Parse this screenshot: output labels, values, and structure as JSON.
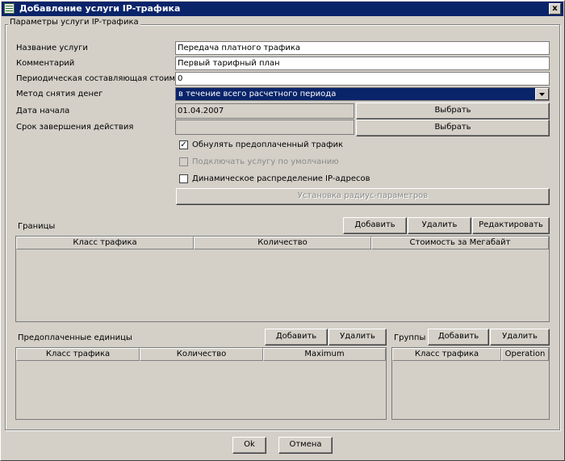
{
  "window": {
    "title": "Добавление услуги IP-трафика",
    "close": "x"
  },
  "group": {
    "legend": "Параметры услуги IP-трафика"
  },
  "form": {
    "service_name_label": "Название услуги",
    "service_name_value": "Передача платного трафика",
    "comment_label": "Комментарий",
    "comment_value": "Первый тарифный план",
    "periodic_label": "Периодическая составляющая стоимости",
    "periodic_value": "0",
    "method_label": "Метод снятия денег",
    "method_value": "в течение всего расчетного периода",
    "start_date_label": "Дата начала",
    "start_date_value": "01.04.2007",
    "end_date_label": "Срок завершения действия",
    "end_date_value": "",
    "choose_label": "Выбрать",
    "chk_reset_label": "Обнулять предоплаченный трафик",
    "chk_reset_mark": "✓",
    "chk_default_label": "Подключать услугу по умолчанию",
    "chk_dynamic_label": "Динамическое распределение IP-адресов",
    "radius_button": "Установка радиус-параметров"
  },
  "limits": {
    "title": "Границы",
    "add": "Добавить",
    "delete": "Удалить",
    "edit": "Редактировать",
    "columns": [
      "Класс трафика",
      "Количество",
      "Стоимость за Мегабайт"
    ]
  },
  "prepaid": {
    "title": "Предоплаченные единицы",
    "add": "Добавить",
    "delete": "Удалить",
    "columns": [
      "Класс трафика",
      "Количество",
      "Maximum"
    ]
  },
  "groups": {
    "title": "Группы",
    "add": "Добавить",
    "delete": "Удалить",
    "columns": [
      "Класс трафика",
      "Operation"
    ]
  },
  "footer": {
    "ok": "Ok",
    "cancel": "Отмена"
  }
}
